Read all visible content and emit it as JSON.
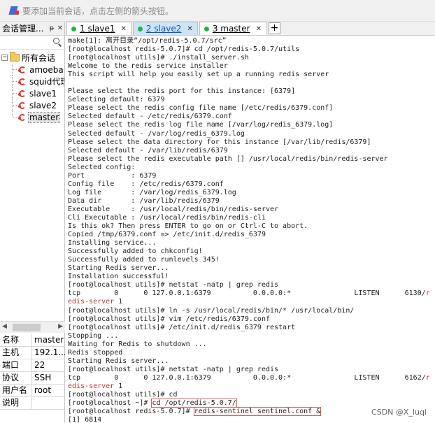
{
  "hint_bar": {
    "text": "要添加当前会话，点击左侧的箭头按钮。"
  },
  "session_manager": {
    "title": "会话管理...",
    "pin_glyph": "ᵽ",
    "close_glyph": "✕",
    "root_expander": "−",
    "root_label": "所有会话",
    "items": [
      {
        "label": "amoeba"
      },
      {
        "label": "squid代理"
      },
      {
        "label": "slave1"
      },
      {
        "label": "slave2"
      },
      {
        "label": "master",
        "selected": true
      }
    ]
  },
  "properties": [
    {
      "key": "名称",
      "value": "master"
    },
    {
      "key": "主机",
      "value": "192.1..."
    },
    {
      "key": "端口",
      "value": "22"
    },
    {
      "key": "协议",
      "value": "SSH"
    },
    {
      "key": "用户名",
      "value": "root"
    },
    {
      "key": "说明",
      "value": ""
    }
  ],
  "tabs": [
    {
      "label": "1 slave1",
      "active": false
    },
    {
      "label": "2 slave2",
      "active": true
    },
    {
      "label": "3 master",
      "active": false
    }
  ],
  "tab_add_glyph": "+",
  "tab_close_glyph": "✕",
  "terminal": {
    "lines": [
      "make[1]: 离开目录“/opt/redis-5.0.7/src”",
      "[root@localhost redis-5.0.7]# cd /opt/redis-5.0.7/utils",
      "[root@localhost utils]# ./install_server.sh",
      "Welcome to the redis service installer",
      "This script will help you easily set up a running redis server",
      "",
      "Please select the redis port for this instance: [6379]",
      "Selecting default: 6379",
      "Please select the redis config file name [/etc/redis/6379.conf]",
      "Selected default - /etc/redis/6379.conf",
      "Please select the redis log file name [/var/log/redis_6379.log]",
      "Selected default - /var/log/redis_6379.log",
      "Please select the data directory for this instance [/var/lib/redis/6379]",
      "Selected default - /var/lib/redis/6379",
      "Please select the redis executable path [] /usr/local/redis/bin/redis-server",
      "Selected config:",
      "Port           : 6379",
      "Config file    : /etc/redis/6379.conf",
      "Log file       : /var/log/redis_6379.log",
      "Data dir       : /var/lib/redis/6379",
      "Executable     : /usr/local/redis/bin/redis-server",
      "Cli Executable : /usr/local/redis/bin/redis-cli",
      "Is this ok? Then press ENTER to go on or Ctrl-C to abort.",
      "Copied /tmp/6379.conf => /etc/init.d/redis_6379",
      "Installing service...",
      "Successfully added to chkconfig!",
      "Successfully added to runlevels 345!",
      "Starting Redis server...",
      "Installation successful!",
      "[root@localhost utils]# netstat -natp | grep redis",
      "tcp        0      0 127.0.0.1:6379          0.0.0.0:*               LISTEN      6130/r",
      "edis-server 1",
      "[root@localhost utils]# ln -s /usr/local/redis/bin/* /usr/local/bin/",
      "[root@localhost utils]# vim /etc/redis/6379.conf",
      "[root@localhost utils]# /etc/init.d/redis_6379 restart",
      "Stopping ...",
      "Waiting for Redis to shutdown ...",
      "Redis stopped",
      "Starting Redis server...",
      "[root@localhost utils]# netstat -natp | grep redis",
      "tcp        0      0 127.0.0.1:6379          0.0.0.0:*               LISTEN      6162/r",
      "edis-server 1",
      "[root@localhost utils]# cd",
      "[root@localhost ~]# cd /opt/redis-5.0.7/",
      "[root@localhost redis-5.0.7]# redis-sentinel sentinel.conf &",
      "[1] 6814"
    ]
  },
  "watermark": "CSDN @X_luqi",
  "colors": {
    "tab_active_bg": "#cde4f7",
    "tab_dot": "#19b83a",
    "session_icon": "#e0352b",
    "highlight_box": "#e05353",
    "terminal_red_text": "#c0392b"
  }
}
